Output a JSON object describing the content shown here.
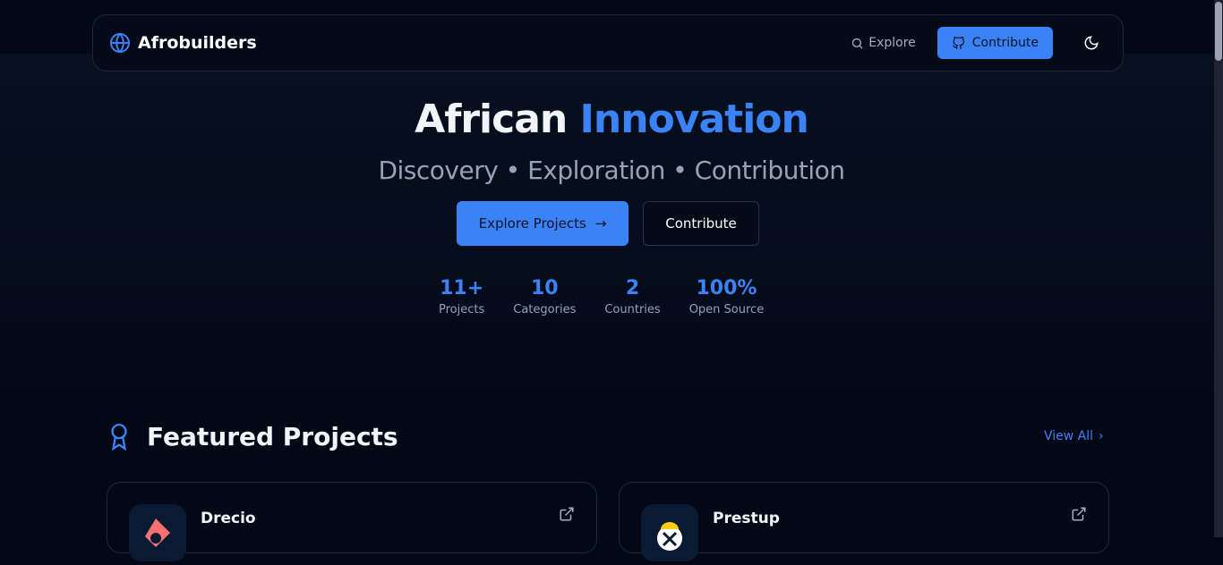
{
  "nav": {
    "brand": "Afrobuilders",
    "explore": "Explore",
    "contribute": "Contribute"
  },
  "hero": {
    "title_a": "African",
    "title_b": "Innovation",
    "subtitle": "Discovery • Exploration • Contribution",
    "explore_btn": "Explore Projects",
    "contribute_btn": "Contribute"
  },
  "stats": [
    {
      "value": "11+",
      "label": "Projects"
    },
    {
      "value": "10",
      "label": "Categories"
    },
    {
      "value": "2",
      "label": "Countries"
    },
    {
      "value": "100%",
      "label": "Open Source"
    }
  ],
  "featured": {
    "title": "Featured Projects",
    "view_all": "View All",
    "projects": [
      {
        "name": "Drecio"
      },
      {
        "name": "Prestup"
      }
    ]
  },
  "colors": {
    "accent": "#3b82f6",
    "bg": "#030816"
  }
}
